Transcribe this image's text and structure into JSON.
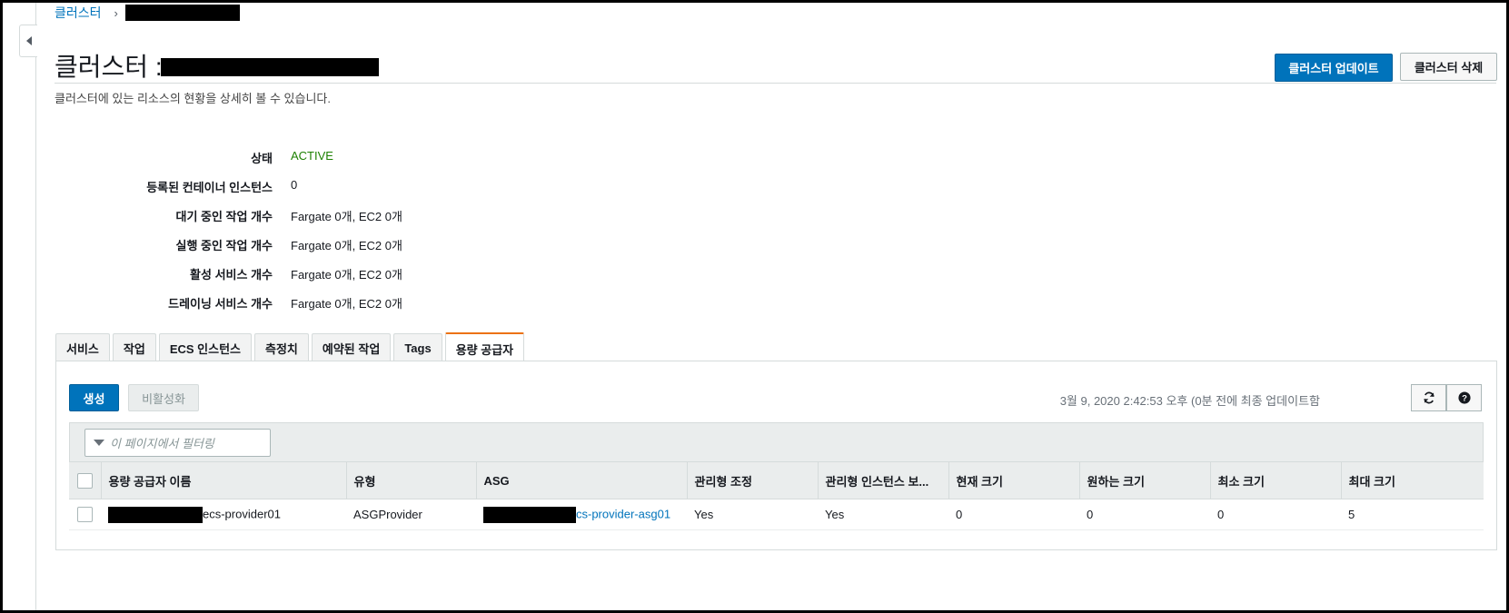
{
  "breadcrumb": {
    "root": "클러스터"
  },
  "header": {
    "title_prefix": "클러스터 : ",
    "subtitle": "클러스터에 있는 리소스의 현황을 상세히 볼 수 있습니다.",
    "update_button": "클러스터 업데이트",
    "delete_button": "클러스터 삭제"
  },
  "details": [
    {
      "label": "상태",
      "value": "ACTIVE"
    },
    {
      "label": "등록된 컨테이너 인스턴스",
      "value": "0"
    },
    {
      "label": "대기 중인 작업 개수",
      "value": "Fargate 0개, EC2 0개"
    },
    {
      "label": "실행 중인 작업 개수",
      "value": "Fargate 0개, EC2 0개"
    },
    {
      "label": "활성 서비스 개수",
      "value": "Fargate 0개, EC2 0개"
    },
    {
      "label": "드레이닝 서비스 개수",
      "value": "Fargate 0개, EC2 0개"
    }
  ],
  "tabs": [
    {
      "label": "서비스"
    },
    {
      "label": "작업"
    },
    {
      "label": "ECS 인스턴스"
    },
    {
      "label": "측정치"
    },
    {
      "label": "예약된 작업"
    },
    {
      "label": "Tags"
    },
    {
      "label": "용량 공급자",
      "active": true
    }
  ],
  "toolbar": {
    "create_label": "생성",
    "deactivate_label": "비활성화",
    "timestamp": "3월 9, 2020 2:42:53 오후 (0분 전에 최종 업데이트함",
    "refresh_icon": "refresh-icon",
    "help_icon": "help-icon"
  },
  "filter": {
    "placeholder": "이 페이지에서 필터링"
  },
  "table": {
    "columns": [
      "용량 공급자 이름",
      "유형",
      "ASG",
      "관리형 조정",
      "관리형 인스턴스 보...",
      "현재 크기",
      "원하는 크기",
      "최소 크기",
      "최대 크기"
    ],
    "rows": [
      {
        "name_suffix": "ecs-provider01",
        "type": "ASGProvider",
        "asg_suffix": "cs-provider-asg01",
        "managed_scaling": "Yes",
        "managed_protection": "Yes",
        "current_size": "0",
        "desired_size": "0",
        "min_size": "0",
        "max_size": "5"
      }
    ]
  },
  "colors": {
    "primary": "#0073bb",
    "active_status": "#1d8102",
    "tab_accent": "#ec7211"
  }
}
